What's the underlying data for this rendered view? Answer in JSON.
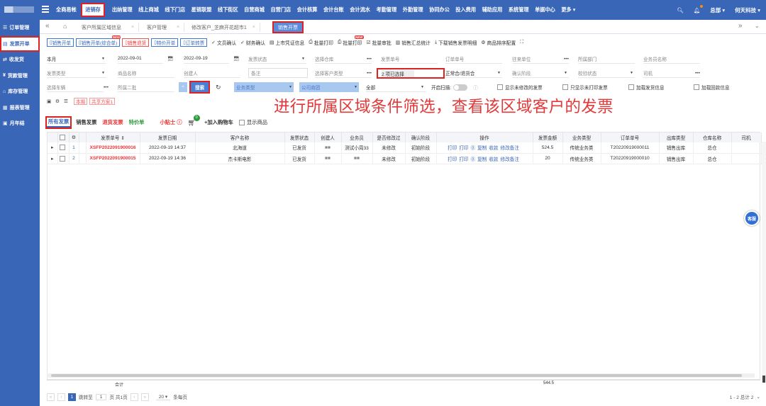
{
  "topbar": {
    "menu": [
      "全商易帐",
      "进销存",
      "出纳管理",
      "线上商城",
      "线下门店",
      "星链联盟",
      "线下街区",
      "自营商城",
      "自营门店",
      "会计核算",
      "会计台账",
      "会计流水",
      "考勤管理",
      "外勤管理",
      "协同办公",
      "投入费用",
      "辅助应用",
      "系统管理",
      "单据中心",
      "更多 ▾"
    ],
    "active_menu": "进销存",
    "user": "总部 ▾",
    "company": "何天科技 ▾"
  },
  "sidebar": [
    "订单管理",
    "发票开单",
    "收发货",
    "货款管理",
    "库存管理",
    "报表管理",
    "月年结"
  ],
  "tabs": {
    "items": [
      "客户所属区域信息",
      "客户管理",
      "修改客户_芝麻开花超市1",
      "销售开票"
    ],
    "nav_left": "«",
    "nav_right": "»"
  },
  "toolbar": {
    "buttons": [
      "销售开单",
      "销售开单(综合单)",
      "销售退货",
      "特价开单",
      "订单转票"
    ],
    "links": [
      "文员确认",
      "财务确认",
      "上市凭证信息",
      "批量打印",
      "批量打印",
      "批量审批",
      "销售汇总统计",
      "下载销售发票明细",
      "商品排序配置"
    ],
    "new_tag": "NEW"
  },
  "filters": {
    "row1": {
      "period": "本月",
      "date_from": "2022-09-01",
      "date_to": "2022-09-19",
      "status": "发票状态",
      "warehouse": "选择仓库",
      "bill_no": "发票单号",
      "order_no": "订单单号",
      "inbound_unit": "往来单位",
      "dept": "所属部门",
      "salesman": "业务员名称"
    },
    "row2": {
      "invoice_type": "发票类型",
      "goods": "商品名称",
      "creator": "创建人",
      "remark": "备注",
      "customer_type": "选择客户类型",
      "region_selected": "2 项已选择",
      "cust_class": "正常合/退货合",
      "confirm_stage": "确认阶段",
      "check_status": "校验状态",
      "driver": "司机"
    },
    "row3": {
      "vehicle": "选择车辆",
      "region_label": "所属二批",
      "search": "搜索",
      "biz_type": "业务类型",
      "company_group": "公司商团",
      "all": "全部",
      "scan": "开启扫描:",
      "cb1": "显示未修改的发票",
      "cb2": "只显示未打印发票",
      "cb3": "加载发货信息",
      "cb4": "加载回款信息"
    },
    "row4": {
      "this_period": "本期",
      "shared": "共享方案1"
    }
  },
  "caption": "进行所属区域条件筛选，查看该区域客户的发票",
  "subtabs": {
    "all": "所有发票",
    "sale": "销售发票",
    "return": "退货发票",
    "special": "特价单",
    "tip": "小贴士 ⓘ",
    "cart_count": "0",
    "add_cart": "+加入购物车",
    "show_goods": "显示商品"
  },
  "table": {
    "columns": [
      "",
      "",
      "",
      "",
      "发票单号 ⇕",
      "发票日期",
      "客户名称",
      "发票状态",
      "创建人",
      "业务员",
      "是否修改过",
      "确认阶段",
      "操作",
      "发票金额",
      "业务类型",
      "订单单号",
      "出库类型",
      "仓库名称",
      "司机"
    ],
    "rows": [
      {
        "idx": "1",
        "bill": "XSFP2022091900016",
        "date": "2022-09-19 14:37",
        "customer": "北海道",
        "status": "已发货",
        "creator": "■■",
        "salesman": "测试小周33",
        "modified": "未修改",
        "stage": "初始阶段",
        "amount": "524.5",
        "biz": "传统业务类",
        "order": "T20220919000011",
        "out": "销售出库",
        "wh": "总仓"
      },
      {
        "idx": "2",
        "bill": "XSFP2022091900015",
        "date": "2022-09-19 14:36",
        "customer": "杰卡斯电影",
        "status": "已发货",
        "creator": "■■",
        "salesman": "■■",
        "modified": "未修改",
        "stage": "初始阶段",
        "amount": "20",
        "biz": "传统业务类",
        "order": "T20220919000010",
        "out": "销售出库",
        "wh": "总仓"
      }
    ],
    "ops": [
      "打印",
      "打印",
      "⓪",
      "复制",
      "收款",
      "修改备注"
    ]
  },
  "summary": {
    "label": "合计",
    "amount": "544.5"
  },
  "pager": {
    "goto": "跳转至",
    "page_input": "1",
    "page_suffix": "页 共1页",
    "size": "20",
    "size_suffix": "条每页",
    "range": "1 - 2 总计 2"
  },
  "help": "客服"
}
